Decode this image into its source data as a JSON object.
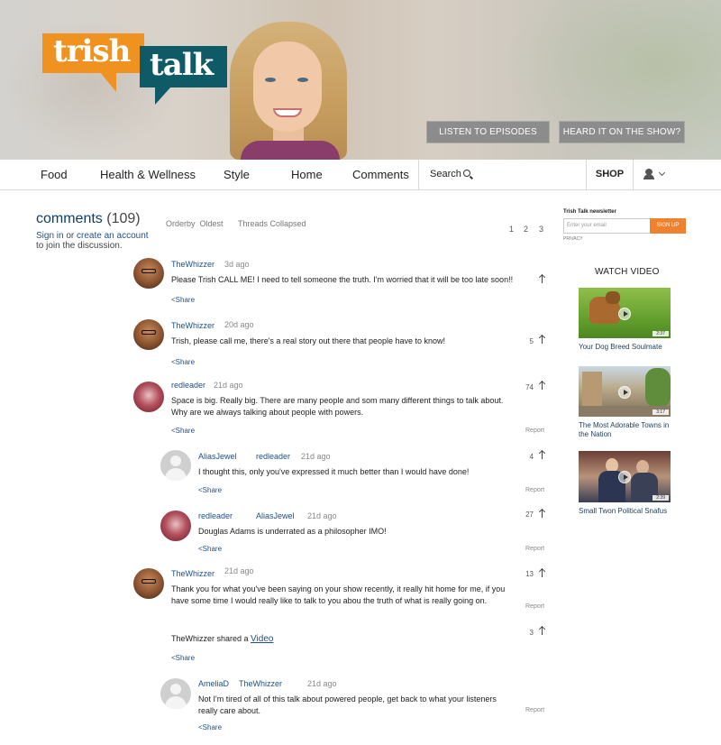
{
  "brand": {
    "logo_word1": "trish",
    "logo_word2": "talk"
  },
  "hero": {
    "listen_label": "LISTEN TO EPISODES",
    "heard_label": "HEARD IT ON THE SHOW?"
  },
  "nav": {
    "items": [
      "Food",
      "Health & Wellness",
      "Style",
      "Home",
      "Comments"
    ],
    "search_label": "Search",
    "shop_label": "SHOP"
  },
  "comments_header": {
    "title": "comments",
    "count": "(109)",
    "signin": "Sign in",
    "or": " or ",
    "create": "create an account",
    "join": "to join the discussion.",
    "orderby_label": "Orderby",
    "orderby_value": "Oldest",
    "threads_label": "Threads Collapsed",
    "pages": [
      "1",
      "2",
      "3"
    ]
  },
  "newsletter": {
    "title": "Trish Talk newsletter",
    "placeholder": "Enter your email",
    "button": "SIGN UP",
    "privacy": "PRIVACY"
  },
  "watch_video": {
    "title": "WATCH VIDEO",
    "videos": [
      {
        "caption": "Your Dog Breed Soulmate",
        "duration": "2:37"
      },
      {
        "caption": "The Most Adorable Towns in the Nation",
        "duration": "3:17"
      },
      {
        "caption": "Small Twon Political Snafus",
        "duration": "2:39"
      }
    ]
  },
  "comments": [
    {
      "user": "TheWhizzer",
      "time": "3d ago",
      "text": "Please Trish CALL ME! I need to tell someone the truth. I'm worried that it will be too late soon!!",
      "votes": "",
      "share": "<Share",
      "report": ""
    },
    {
      "user": "TheWhizzer",
      "time": "20d ago",
      "text": "Trish, please call me, there's a real story out there that people have to know!",
      "votes": "5",
      "share": "<Share",
      "report": ""
    },
    {
      "user": "redleader",
      "time": "21d ago",
      "text": "Space is big. Really big. There are many people and som many different things to talk about. Why are we always talking about people with powers.",
      "votes": "74",
      "share": "<Share",
      "report": "Report"
    },
    {
      "user": "AliasJewel",
      "reply_to": "redleader",
      "time": "21d ago",
      "text": "I thought this, only you've expressed it much better than I would have done!",
      "votes": "4",
      "share": "<Share",
      "report": "Report"
    },
    {
      "user": "redleader",
      "reply_to": "AliasJewel",
      "time": "21d ago",
      "text": "Douglas Adams is underrated as a philosopher IMO!",
      "votes": "27",
      "share": "<Share",
      "report": "Report"
    },
    {
      "user": "TheWhizzer",
      "time": "21d ago",
      "text": "Thank you for what you've been saying on your show recently, it really hit home for me, if you have some time I would really like to talk to you abou the truth of what is really going on.",
      "votes": "13",
      "share": "<Share",
      "report": "Report",
      "shared_prefix": "TheWhizzer shared a ",
      "shared_link": "Video",
      "shared_votes": "3"
    },
    {
      "user": "AmeliaD",
      "reply_to": "TheWhizzer",
      "time": "21d ago",
      "text": "Not I'm tired of all of this talk about powered people, get back to what your listeners really care about.",
      "votes": "",
      "share": "<Share",
      "report": "Report"
    }
  ]
}
